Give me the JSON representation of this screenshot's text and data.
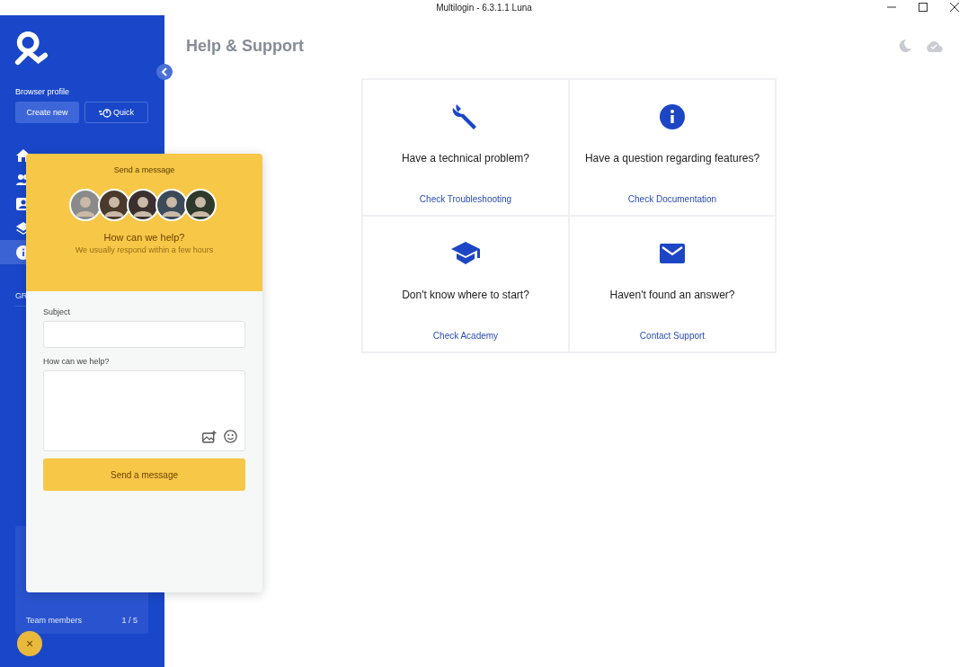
{
  "window": {
    "title": "Multilogin - 6.3.1.1 Luna"
  },
  "sidebar": {
    "section_label": "Browser profile",
    "create_button": "Create new",
    "quick_button": "Quick",
    "nav_items": [
      {
        "selected": false
      },
      {
        "selected": false
      },
      {
        "selected": false
      },
      {
        "selected": false
      },
      {
        "selected": true
      }
    ],
    "group_heading": "GR",
    "plan_rows": [
      {
        "label": "Team members",
        "value": "1 / 5"
      }
    ]
  },
  "page": {
    "title": "Help & Support",
    "cards": [
      {
        "question": "Have a technical problem?",
        "link": "Check Troubleshooting"
      },
      {
        "question": "Have a question regarding features?",
        "link": "Check Documentation"
      },
      {
        "question": "Don't know where to start?",
        "link": "Check Academy"
      },
      {
        "question": "Haven't found an answer?",
        "link": "Contact Support"
      }
    ]
  },
  "chat": {
    "header": "Send a message",
    "heading": "How can we help?",
    "subheading": "We usually respond within a few hours",
    "subject_label": "Subject",
    "message_label": "How can we help?",
    "send_button": "Send a message",
    "close": "×"
  }
}
